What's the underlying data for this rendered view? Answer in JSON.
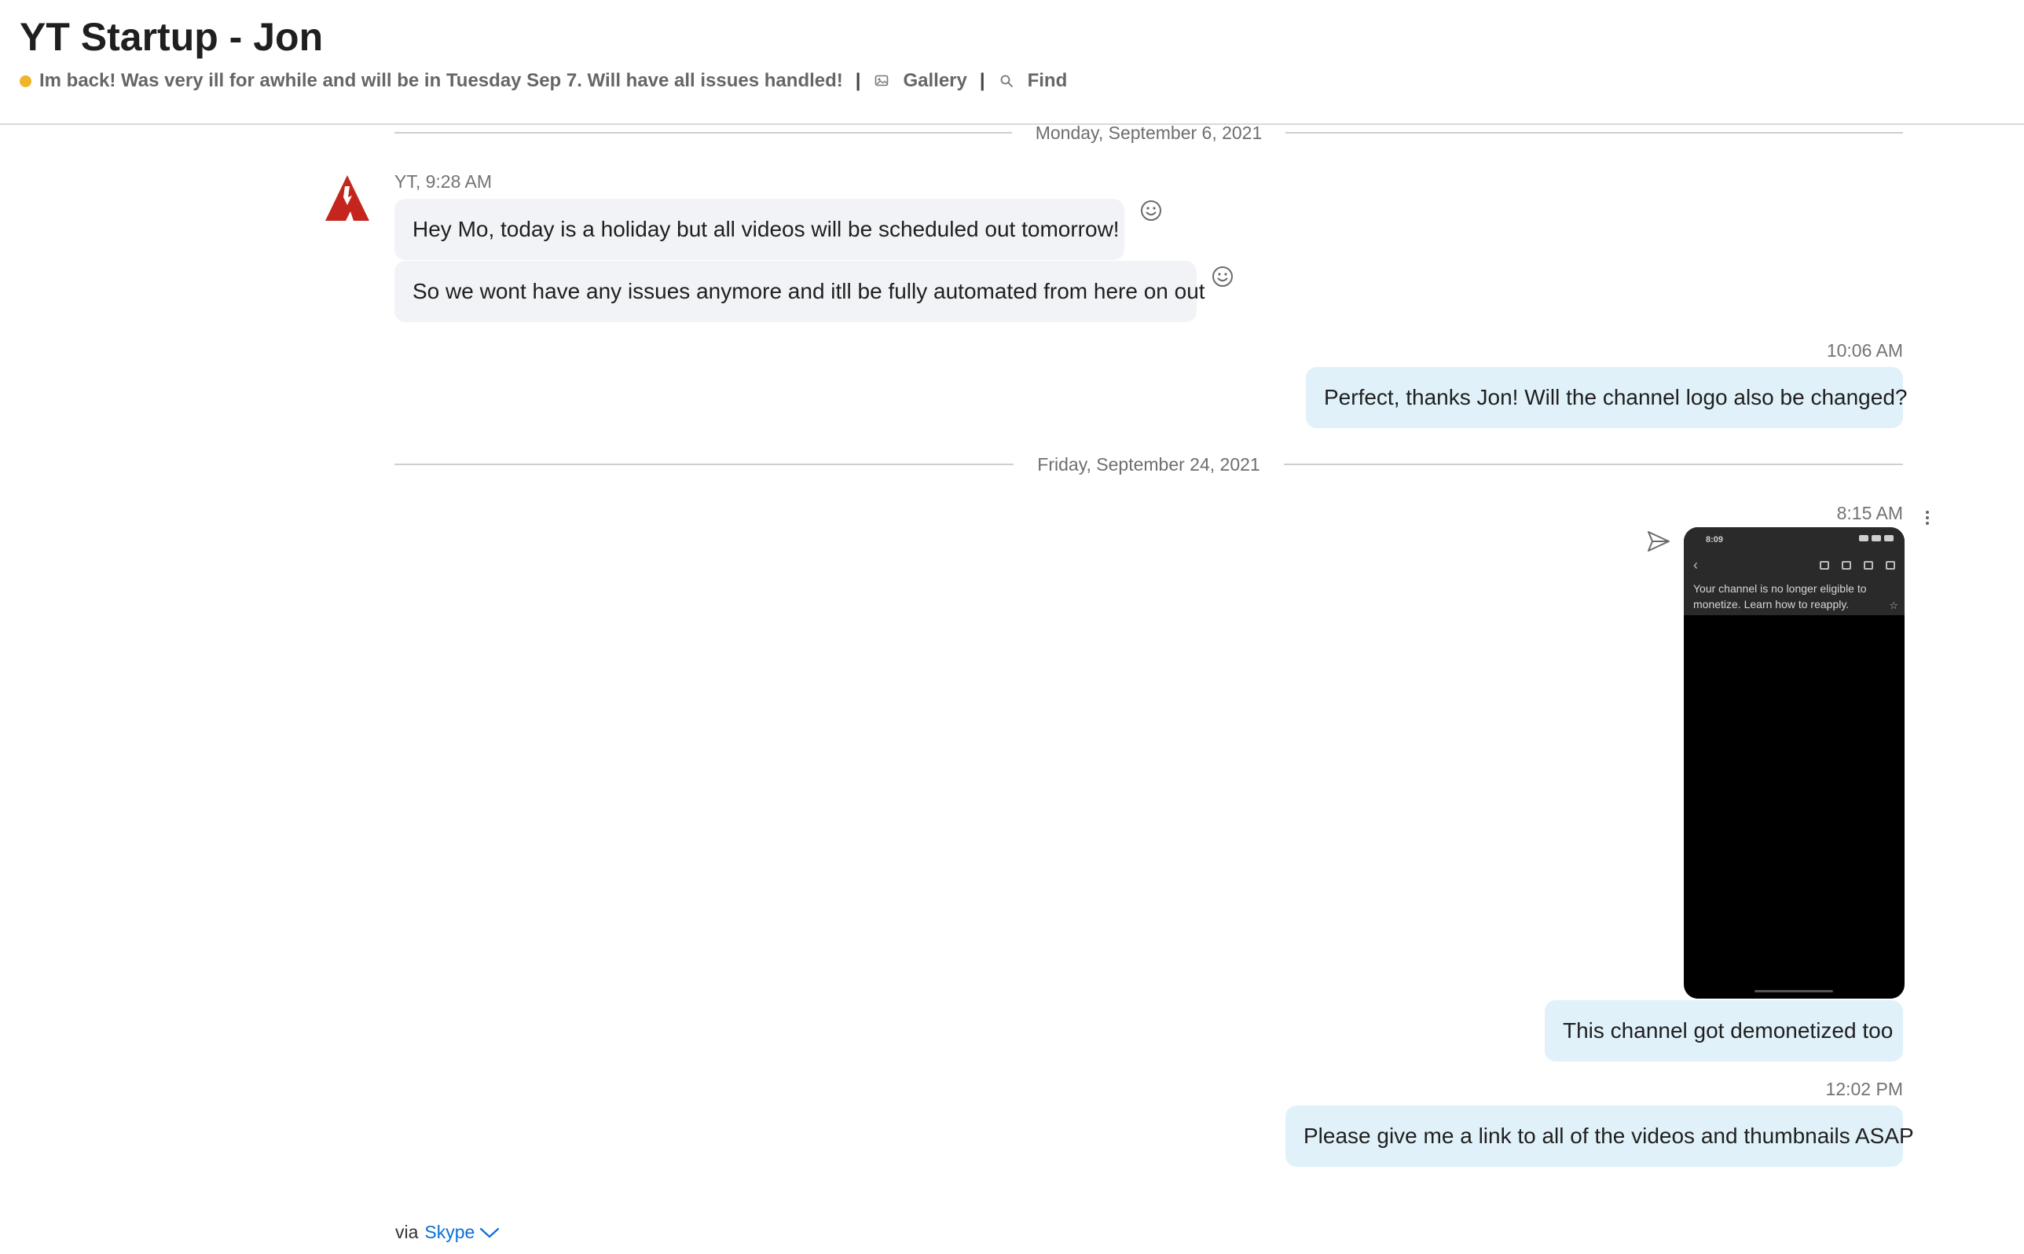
{
  "header": {
    "title": "YT Startup - Jon",
    "status_message": "Im back! Was very ill for awhile and will be in Tuesday Sep 7. Will have all issues handled!",
    "separator": "|",
    "gallery_label": "Gallery",
    "find_label": "Find"
  },
  "conversation": {
    "dividers": [
      "Monday, September 6, 2021",
      "Friday, September 24, 2021"
    ],
    "incoming": {
      "sender_meta": "YT, 9:28 AM",
      "messages": [
        "Hey Mo, today is a holiday but all videos will be scheduled out tomorrow!",
        "So we wont have any issues anymore and itll be fully automated from here on out"
      ]
    },
    "outgoing": [
      {
        "time": "10:06 AM",
        "text": "Perfect, thanks Jon! Will the channel logo also be changed?"
      },
      {
        "time": "8:15 AM",
        "text": "This channel got demonetized too"
      },
      {
        "time": "12:02 PM",
        "text": "Please give me a link to all of the videos and thumbnails ASAP"
      }
    ],
    "attachment": {
      "status_time": "8:09",
      "notice": "Your channel is no longer eligible to monetize. Learn how to reapply."
    }
  },
  "footer": {
    "via": "via",
    "link": "Skype"
  },
  "colors": {
    "status": "#f0b429",
    "incoming_bubble": "#f1f3f6",
    "outgoing_bubble": "#e1f1fa",
    "link": "#0a6fd6",
    "avatar": "#c4261d"
  }
}
